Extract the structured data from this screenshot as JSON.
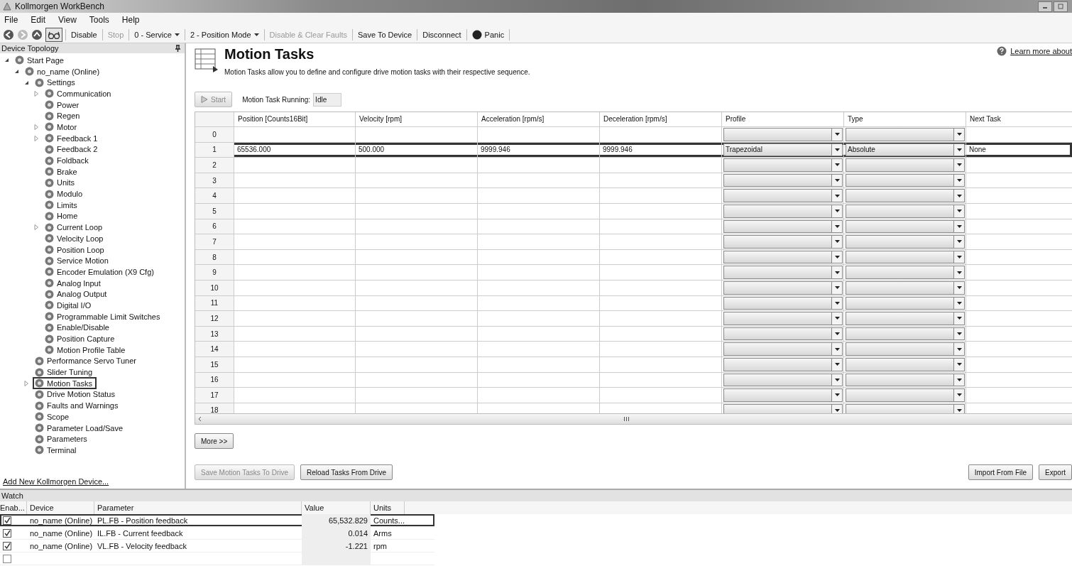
{
  "window": {
    "title": "Kollmorgen WorkBench"
  },
  "menu": [
    "File",
    "Edit",
    "View",
    "Tools",
    "Help"
  ],
  "toolbar": [
    {
      "kind": "back",
      "disabled": false
    },
    {
      "kind": "forward",
      "disabled": true
    },
    {
      "kind": "up",
      "disabled": false
    },
    {
      "kind": "toggle",
      "selected": true
    },
    {
      "kind": "button",
      "label": "Disable",
      "disabled": false
    },
    {
      "kind": "button",
      "label": "Stop",
      "disabled": true
    },
    {
      "kind": "dropdown",
      "label": "0 - Service",
      "disabled": false
    },
    {
      "kind": "dropdown",
      "label": "2 - Position Mode",
      "disabled": false
    },
    {
      "kind": "button",
      "label": "Disable & Clear Faults",
      "disabled": true
    },
    {
      "kind": "button",
      "label": "Save To Device",
      "disabled": false
    },
    {
      "kind": "button",
      "label": "Disconnect",
      "disabled": false
    },
    {
      "kind": "panic",
      "label": "Panic",
      "disabled": false
    }
  ],
  "sidebar": {
    "title": "Device Topology",
    "link": "Add New Kollmorgen Device...",
    "tree": [
      {
        "label": "Start Page",
        "expandable": true,
        "expanded": true,
        "highlighted": false,
        "children": [
          {
            "label": "no_name (Online)",
            "expandable": true,
            "expanded": true,
            "highlighted": false,
            "children": [
              {
                "label": "Settings",
                "expandable": true,
                "expanded": true,
                "highlighted": false,
                "children": [
                  {
                    "label": "Communication",
                    "expandable": true,
                    "expanded": false,
                    "highlighted": false
                  },
                  {
                    "label": "Power",
                    "expandable": false,
                    "highlighted": false
                  },
                  {
                    "label": "Regen",
                    "expandable": false,
                    "highlighted": false
                  },
                  {
                    "label": "Motor",
                    "expandable": true,
                    "expanded": false,
                    "highlighted": false
                  },
                  {
                    "label": "Feedback 1",
                    "expandable": true,
                    "expanded": false,
                    "highlighted": false
                  },
                  {
                    "label": "Feedback 2",
                    "expandable": false,
                    "highlighted": false
                  },
                  {
                    "label": "Foldback",
                    "expandable": false,
                    "highlighted": false
                  },
                  {
                    "label": "Brake",
                    "expandable": false,
                    "highlighted": false
                  },
                  {
                    "label": "Units",
                    "expandable": false,
                    "highlighted": false
                  },
                  {
                    "label": "Modulo",
                    "expandable": false,
                    "highlighted": false
                  },
                  {
                    "label": "Limits",
                    "expandable": false,
                    "highlighted": false
                  },
                  {
                    "label": "Home",
                    "expandable": false,
                    "highlighted": false
                  },
                  {
                    "label": "Current Loop",
                    "expandable": true,
                    "expanded": false,
                    "highlighted": false
                  },
                  {
                    "label": "Velocity Loop",
                    "expandable": false,
                    "highlighted": false
                  },
                  {
                    "label": "Position Loop",
                    "expandable": false,
                    "highlighted": false
                  },
                  {
                    "label": "Service Motion",
                    "expandable": false,
                    "highlighted": false
                  },
                  {
                    "label": "Encoder Emulation (X9 Cfg)",
                    "expandable": false,
                    "highlighted": false
                  },
                  {
                    "label": "Analog Input",
                    "expandable": false,
                    "highlighted": false
                  },
                  {
                    "label": "Analog Output",
                    "expandable": false,
                    "highlighted": false
                  },
                  {
                    "label": "Digital I/O",
                    "expandable": false,
                    "highlighted": false
                  },
                  {
                    "label": "Programmable Limit Switches",
                    "expandable": false,
                    "highlighted": false
                  },
                  {
                    "label": "Enable/Disable",
                    "expandable": false,
                    "highlighted": false
                  },
                  {
                    "label": "Position Capture",
                    "expandable": false,
                    "highlighted": false
                  },
                  {
                    "label": "Motion Profile Table",
                    "expandable": false,
                    "highlighted": false
                  }
                ]
              },
              {
                "label": "Performance Servo Tuner",
                "expandable": false,
                "highlighted": false
              },
              {
                "label": "Slider Tuning",
                "expandable": false,
                "highlighted": false
              },
              {
                "label": "Motion Tasks",
                "expandable": true,
                "expanded": false,
                "highlighted": true
              },
              {
                "label": "Drive Motion Status",
                "expandable": false,
                "highlighted": false
              },
              {
                "label": "Faults and Warnings",
                "expandable": false,
                "highlighted": false
              },
              {
                "label": "Scope",
                "expandable": false,
                "highlighted": false
              },
              {
                "label": "Parameter Load/Save",
                "expandable": false,
                "highlighted": false
              },
              {
                "label": "Parameters",
                "expandable": false,
                "highlighted": false
              },
              {
                "label": "Terminal",
                "expandable": false,
                "highlighted": false
              }
            ]
          }
        ]
      }
    ]
  },
  "page": {
    "title": "Motion Tasks",
    "description": "Motion Tasks allow you to define and configure drive motion tasks with their respective sequence.",
    "help_link": "Learn more about",
    "start_button": {
      "label": "Start",
      "disabled": true
    },
    "status_label": "Motion Task Running:",
    "status_value": "Idle"
  },
  "table": {
    "columns": [
      {
        "label": "Position [Counts16Bit]",
        "kind": "text"
      },
      {
        "label": "Velocity [rpm]",
        "kind": "text"
      },
      {
        "label": "Acceleration [rpm/s]",
        "kind": "text"
      },
      {
        "label": "Deceleration [rpm/s]",
        "kind": "text"
      },
      {
        "label": "Profile",
        "kind": "dropdown"
      },
      {
        "label": "Type",
        "kind": "dropdown"
      },
      {
        "label": "Next Task",
        "kind": "text"
      }
    ],
    "rows": [
      {
        "number": "0",
        "highlighted": false,
        "cells": []
      },
      {
        "number": "1",
        "highlighted": true,
        "cells": [
          "65536.000",
          "500.000",
          "9999.946",
          "9999.946",
          "Trapezoidal",
          "Absolute",
          "None"
        ]
      },
      {
        "number": "2",
        "highlighted": false,
        "cells": []
      },
      {
        "number": "3",
        "highlighted": false,
        "cells": []
      },
      {
        "number": "4",
        "highlighted": false,
        "cells": []
      },
      {
        "number": "5",
        "highlighted": false,
        "cells": []
      },
      {
        "number": "6",
        "highlighted": false,
        "cells": []
      },
      {
        "number": "7",
        "highlighted": false,
        "cells": []
      },
      {
        "number": "8",
        "highlighted": false,
        "cells": []
      },
      {
        "number": "9",
        "highlighted": false,
        "cells": []
      },
      {
        "number": "10",
        "highlighted": false,
        "cells": []
      },
      {
        "number": "11",
        "highlighted": false,
        "cells": []
      },
      {
        "number": "12",
        "highlighted": false,
        "cells": []
      },
      {
        "number": "13",
        "highlighted": false,
        "cells": []
      },
      {
        "number": "14",
        "highlighted": false,
        "cells": []
      },
      {
        "number": "15",
        "highlighted": false,
        "cells": []
      },
      {
        "number": "16",
        "highlighted": false,
        "cells": []
      },
      {
        "number": "17",
        "highlighted": false,
        "cells": []
      },
      {
        "number": "18",
        "highlighted": false,
        "cells": []
      }
    ]
  },
  "buttons": {
    "more": "More >>",
    "left": [
      {
        "label": "Save Motion Tasks To Drive",
        "disabled": true
      },
      {
        "label": "Reload Tasks From Drive",
        "disabled": false
      }
    ],
    "right": [
      {
        "label": "Import From File",
        "disabled": false
      },
      {
        "label": "Export",
        "disabled": false
      }
    ]
  },
  "watch": {
    "title": "Watch",
    "columns": [
      "Enab...",
      "Device",
      "Parameter",
      "Value",
      "Units"
    ],
    "rows": [
      {
        "enabled": true,
        "highlighted": true,
        "device": "no_name (Online)",
        "parameter": "PL.FB - Position feedback",
        "value": "65,532.829",
        "units": "Counts..."
      },
      {
        "enabled": true,
        "highlighted": false,
        "device": "no_name (Online)",
        "parameter": "IL.FB - Current feedback",
        "value": "0.014",
        "units": "Arms"
      },
      {
        "enabled": true,
        "highlighted": false,
        "device": "no_name (Online)",
        "parameter": "VL.FB - Velocity feedback",
        "value": "-1.221",
        "units": "rpm"
      },
      {
        "enabled": false,
        "highlighted": false
      }
    ]
  }
}
